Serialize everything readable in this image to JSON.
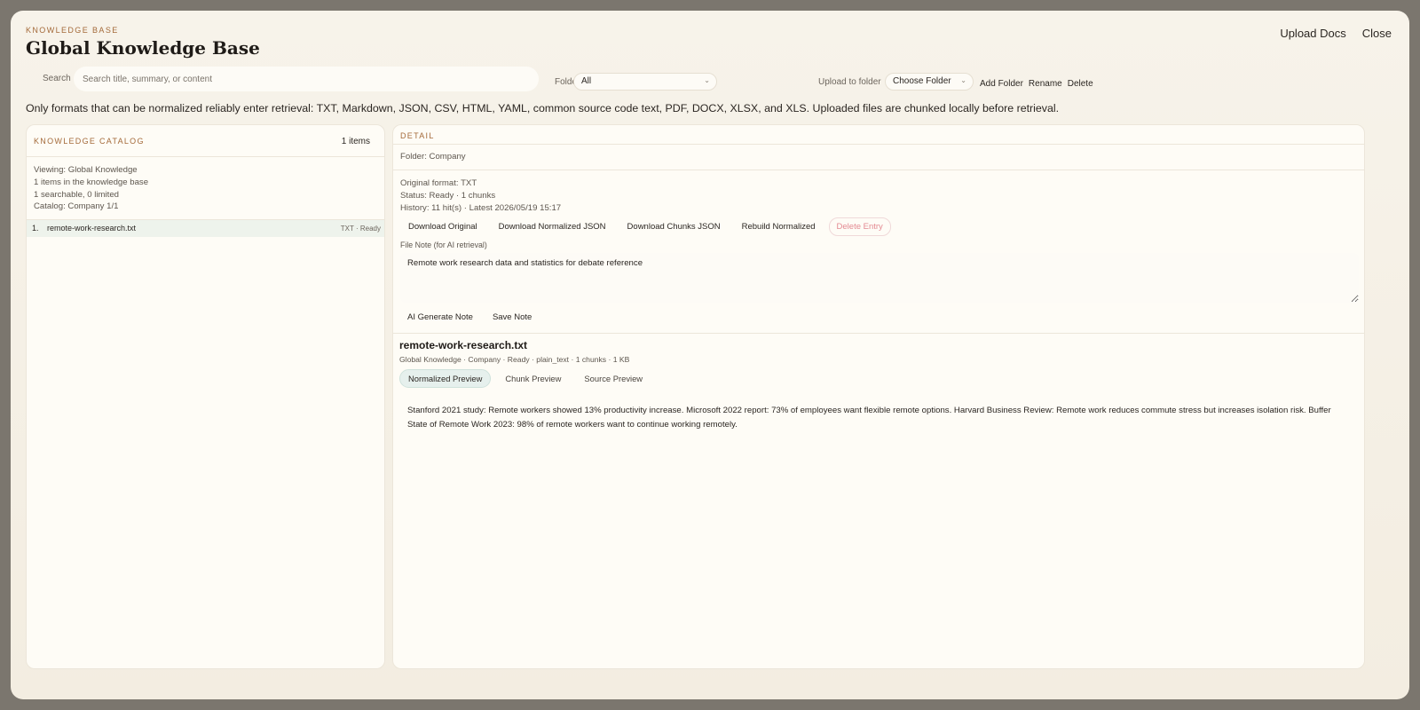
{
  "header": {
    "eyebrow": "KNOWLEDGE BASE",
    "title": "Global Knowledge Base",
    "upload_label": "Upload Docs",
    "close_label": "Close"
  },
  "filters": {
    "search_label": "Search",
    "search_placeholder": "Search title, summary, or content",
    "folder_label": "Folder",
    "folder_value": "All",
    "upload_to_label": "Upload to folder",
    "upload_to_value": "Choose Folder",
    "add_folder": "Add Folder",
    "rename": "Rename",
    "delete": "Delete"
  },
  "notice": "Only formats that can be normalized reliably enter retrieval: TXT, Markdown, JSON, CSV, HTML, YAML, common source code text, PDF, DOCX, XLSX, and XLS. Uploaded files are chunked locally before retrieval.",
  "catalog": {
    "title": "KNOWLEDGE CATALOG",
    "count": "1 items",
    "meta": [
      "Viewing: Global Knowledge",
      "1 items in the knowledge base",
      "1 searchable, 0 limited",
      "Catalog: Company 1/1"
    ],
    "items": [
      {
        "num": "1.",
        "name": "remote-work-research.txt",
        "status": "TXT · Ready"
      }
    ]
  },
  "detail": {
    "title": "DETAIL",
    "folder": "Folder: Company",
    "info": [
      "Original format: TXT",
      "Status: Ready · 1 chunks",
      "History: 11 hit(s) · Latest 2026/05/19 15:17"
    ],
    "buttons": {
      "download_original": "Download Original",
      "download_normalized": "Download Normalized JSON",
      "download_chunks": "Download Chunks JSON",
      "rebuild": "Rebuild Normalized",
      "delete_entry": "Delete Entry"
    },
    "file_note_label": "File Note (for AI retrieval)",
    "file_note_value": "Remote work research data and statistics for debate reference",
    "ai_generate": "AI Generate Note",
    "save_note": "Save Note",
    "file_title": "remote-work-research.txt",
    "file_meta": "Global Knowledge · Company · Ready · plain_text · 1 chunks · 1 KB",
    "tabs": {
      "normalized": "Normalized Preview",
      "chunk": "Chunk Preview",
      "source": "Source Preview"
    },
    "preview": "Stanford 2021 study: Remote workers showed 13% productivity increase. Microsoft 2022 report: 73% of employees want flexible remote options. Harvard Business Review: Remote work reduces commute stress but increases isolation risk. Buffer State of Remote Work 2023: 98% of remote workers want to continue working remotely."
  }
}
